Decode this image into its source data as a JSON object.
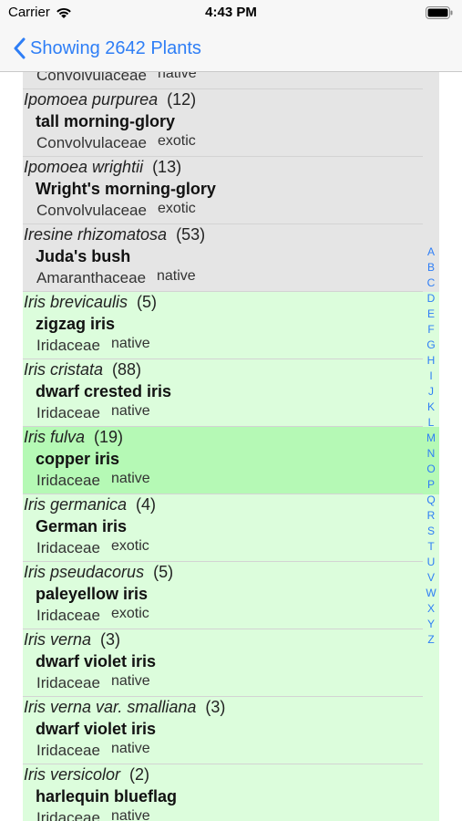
{
  "status_bar": {
    "carrier": "Carrier",
    "time": "4:43 PM"
  },
  "nav": {
    "back_label": "Showing 2642 Plants"
  },
  "rows": [
    {
      "scientific": "",
      "count": "",
      "common": "",
      "family": "Convolvulaceae",
      "status": "native",
      "style": "gray"
    },
    {
      "scientific": "Ipomoea purpurea",
      "count": "12",
      "common": "tall morning-glory",
      "family": "Convolvulaceae",
      "status": "exotic",
      "style": "gray"
    },
    {
      "scientific": "Ipomoea wrightii",
      "count": "13",
      "common": "Wright's morning-glory",
      "family": "Convolvulaceae",
      "status": "exotic",
      "style": "gray"
    },
    {
      "scientific": "Iresine rhizomatosa",
      "count": "53",
      "common": "Juda's bush",
      "family": "Amaranthaceae",
      "status": "native",
      "style": "gray"
    },
    {
      "scientific": "Iris brevicaulis",
      "count": "5",
      "common": "zigzag iris",
      "family": "Iridaceae",
      "status": "native",
      "style": "green"
    },
    {
      "scientific": "Iris cristata",
      "count": "88",
      "common": "dwarf crested iris",
      "family": "Iridaceae",
      "status": "native",
      "style": "green"
    },
    {
      "scientific": "Iris fulva",
      "count": "19",
      "common": "copper iris",
      "family": "Iridaceae",
      "status": "native",
      "style": "selected"
    },
    {
      "scientific": "Iris germanica",
      "count": "4",
      "common": "German iris",
      "family": "Iridaceae",
      "status": "exotic",
      "style": "green"
    },
    {
      "scientific": "Iris pseudacorus",
      "count": "5",
      "common": "paleyellow iris",
      "family": "Iridaceae",
      "status": "exotic",
      "style": "green"
    },
    {
      "scientific": "Iris verna",
      "count": "3",
      "common": "dwarf violet iris",
      "family": "Iridaceae",
      "status": "native",
      "style": "green"
    },
    {
      "scientific": "Iris verna var. smalliana",
      "count": "3",
      "common": "dwarf violet iris",
      "family": "Iridaceae",
      "status": "native",
      "style": "green"
    },
    {
      "scientific": "Iris versicolor",
      "count": "2",
      "common": "harlequin blueflag",
      "family": "Iridaceae",
      "status": "native",
      "style": "green"
    }
  ],
  "index_letters": [
    "A",
    "B",
    "C",
    "D",
    "E",
    "F",
    "G",
    "H",
    "I",
    "J",
    "K",
    "L",
    "M",
    "N",
    "O",
    "P",
    "Q",
    "R",
    "S",
    "T",
    "U",
    "V",
    "W",
    "X",
    "Y",
    "Z"
  ],
  "colors": {
    "accent": "#2e7ef6",
    "row_gray": "#e5e5e5",
    "row_green": "#dcfddc",
    "row_selected": "#b5f9b5"
  },
  "icons": {
    "back": "chevron-left-icon",
    "wifi": "wifi-icon",
    "battery": "battery-icon"
  }
}
